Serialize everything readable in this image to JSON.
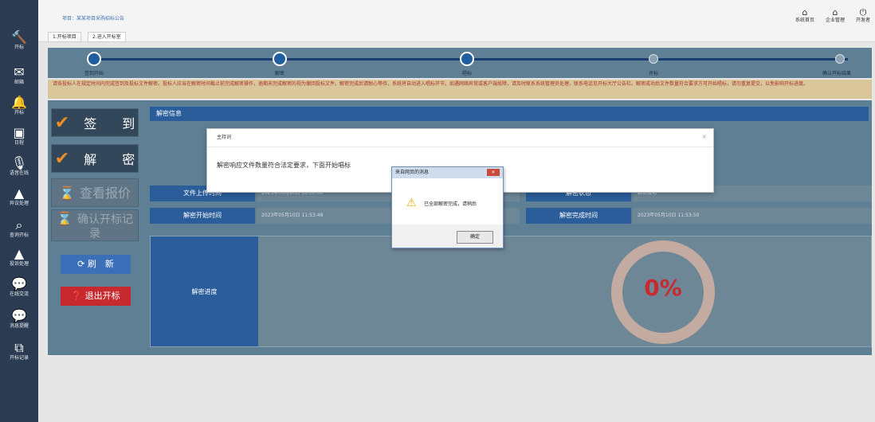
{
  "sidebar": {
    "items": [
      {
        "icon": "hammer-icon",
        "glyph": "🔨",
        "label": "开标"
      },
      {
        "icon": "mail-icon",
        "glyph": "✉",
        "label": "邮箱"
      },
      {
        "icon": "bell-icon",
        "glyph": "🔔",
        "label": "开标"
      },
      {
        "icon": "calendar-icon",
        "glyph": "▣",
        "label": "日程"
      },
      {
        "icon": "mic-icon",
        "glyph": "🎙",
        "label": "语音在线"
      },
      {
        "icon": "warning-icon",
        "glyph": "▲",
        "label": "异议处理"
      },
      {
        "icon": "search-icon",
        "glyph": "⌕",
        "label": "查询开标"
      },
      {
        "icon": "alert-icon",
        "glyph": "▲",
        "label": "投诉处理"
      },
      {
        "icon": "chat-icon",
        "glyph": "💬",
        "label": "在线交流"
      },
      {
        "icon": "message-icon",
        "glyph": "💬",
        "label": "消息提醒"
      },
      {
        "icon": "copy-icon",
        "glyph": "⧉",
        "label": "开标记录"
      }
    ]
  },
  "header": {
    "project_title": "项目：某某项目采购招标公告",
    "tabs": [
      "1.开标项目",
      "2.进入开标室"
    ],
    "actions": [
      {
        "icon": "home-icon",
        "glyph": "⌂",
        "label": "系统首页"
      },
      {
        "icon": "home2-icon",
        "glyph": "⌂",
        "label": "企业管理"
      },
      {
        "icon": "power-icon",
        "glyph": "⏻",
        "label": "开发者"
      }
    ]
  },
  "steps": {
    "labels": [
      "签到开始",
      "解密",
      "唱标",
      "评标",
      "确认开标结果"
    ]
  },
  "notice": {
    "text": "请各投标人在规定时间内完成签到及投标文件解密。投标人应当在解密时间截止前完成解密操作，逾期未完成解密的视为撤回投标文件。解密完成后请耐心等待，系统将自动进入唱标环节。如遇网络异常或客户端故障，请及时联系系统管理员处理，联系电话见开标大厅公告栏。解密成功后文件数量符合要求方可开始唱标，请勿重复提交，以免影响开标进度。"
  },
  "side_buttons": {
    "signin": "签　　到",
    "decrypt": "解　　密",
    "view_quote": "查看报价",
    "confirm_record": "确认开标记录",
    "refresh": "刷　新",
    "exit": "退出开标"
  },
  "panel": {
    "title": "解密信息",
    "row1": [
      {
        "label": "文件上传时间",
        "value": "2023年05月10日 10:00:00"
      },
      {
        "label": "解密状态",
        "value": "解密成功"
      }
    ],
    "row2": [
      {
        "label": "解密开始时间",
        "value": "2023年05月10日 11:53:48"
      },
      {
        "label": "解密完成时间",
        "value": "2023年05月10日 11:53:50"
      }
    ],
    "progress_label": "解密进度",
    "progress_text": "0%",
    "progress_value": 0
  },
  "dialog": {
    "title": "主持词",
    "message": "解密响应文件数量符合法定要求，下面开始唱标",
    "close": "×"
  },
  "msgbox": {
    "title": "来自网页的消息",
    "close": "✕",
    "message": "已全部解密完成，请稍后",
    "ok": "确定"
  }
}
